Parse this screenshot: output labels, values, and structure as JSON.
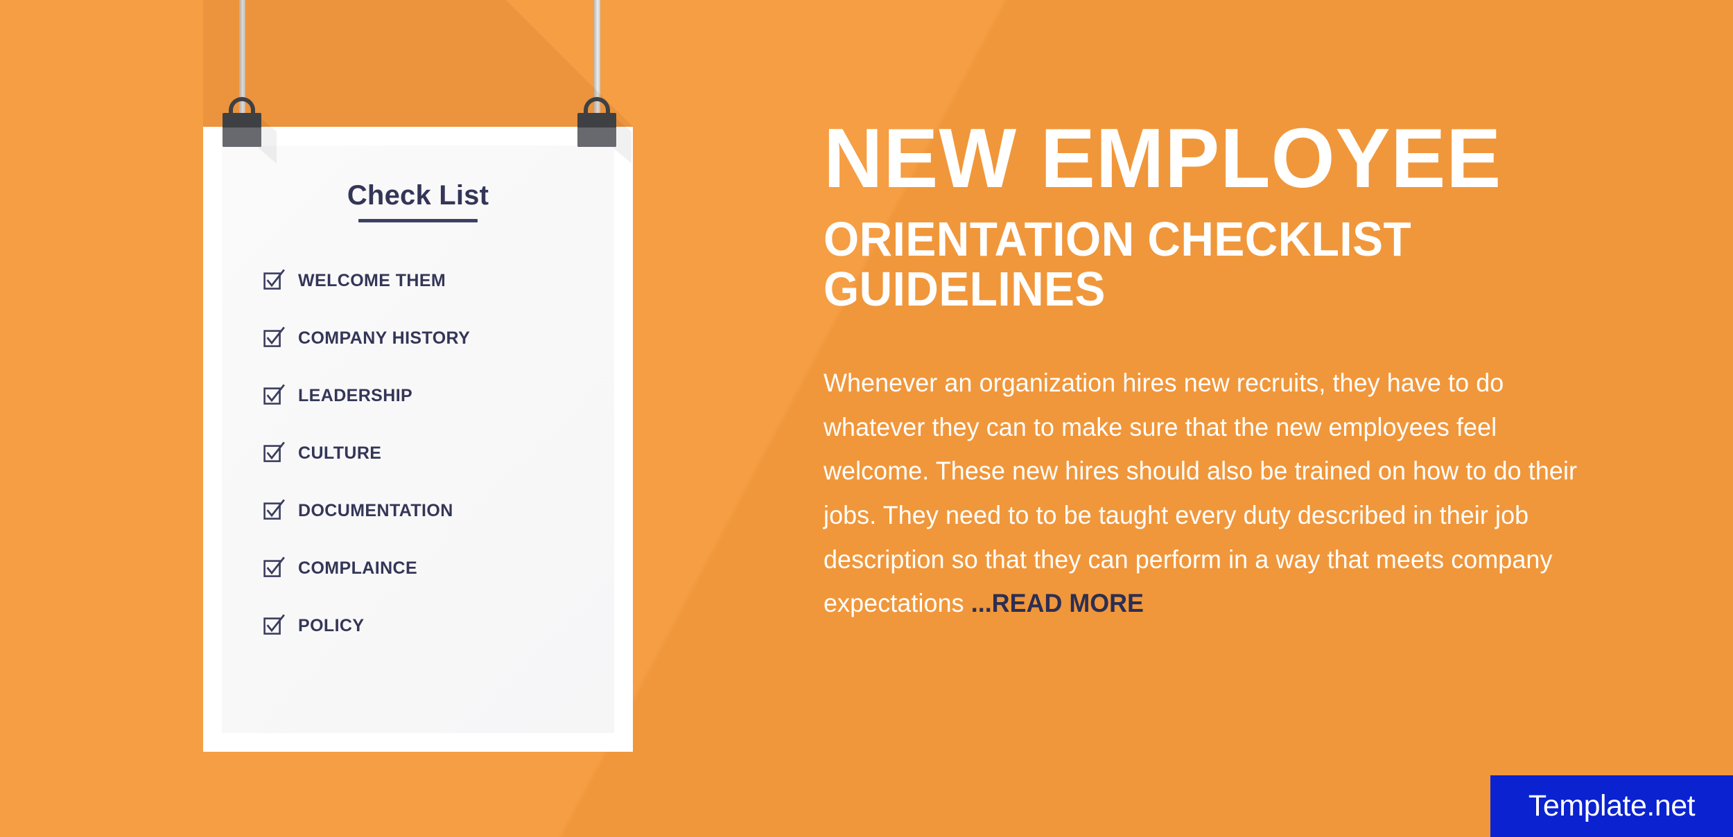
{
  "theme": {
    "background_orange": "#F59A3C",
    "navy": "#343657",
    "paper_white": "#FFFFFF",
    "paper_inner": "#F8F8F9",
    "clip_dark": "#3F4044",
    "clip_light": "#68696E",
    "string_gray": "#D6D8DA",
    "badge_blue": "#0A22D0"
  },
  "paper": {
    "checklist_title": "Check List",
    "items": [
      {
        "label": "WELCOME THEM",
        "icon": "checked-box-icon",
        "checked": true
      },
      {
        "label": "COMPANY HISTORY",
        "icon": "checked-box-icon",
        "checked": true
      },
      {
        "label": "LEADERSHIP",
        "icon": "checked-box-icon",
        "checked": true
      },
      {
        "label": "CULTURE",
        "icon": "checked-box-icon",
        "checked": true
      },
      {
        "label": "DOCUMENTATION",
        "icon": "checked-box-icon",
        "checked": true
      },
      {
        "label": "COMPLAINCE",
        "icon": "checked-box-icon",
        "checked": true
      },
      {
        "label": "POLICY",
        "icon": "checked-box-icon",
        "checked": true
      }
    ],
    "clips": [
      {
        "name": "binder-clip-left"
      },
      {
        "name": "binder-clip-right"
      }
    ]
  },
  "headline": {
    "line1": "NEW EMPLOYEE",
    "line2": "ORIENTATION CHECKLIST",
    "line3": "GUIDELINES"
  },
  "body": {
    "paragraph": "Whenever an organization hires new recruits, they have to do whatever they can to make sure that the new employees feel welcome. These new hires should also be trained on how to do their jobs. They need to to be taught every duty described in their job description so that they can perform in a way that meets company expectations ",
    "read_more": "...READ MORE"
  },
  "badge": {
    "label": "Template.net"
  }
}
